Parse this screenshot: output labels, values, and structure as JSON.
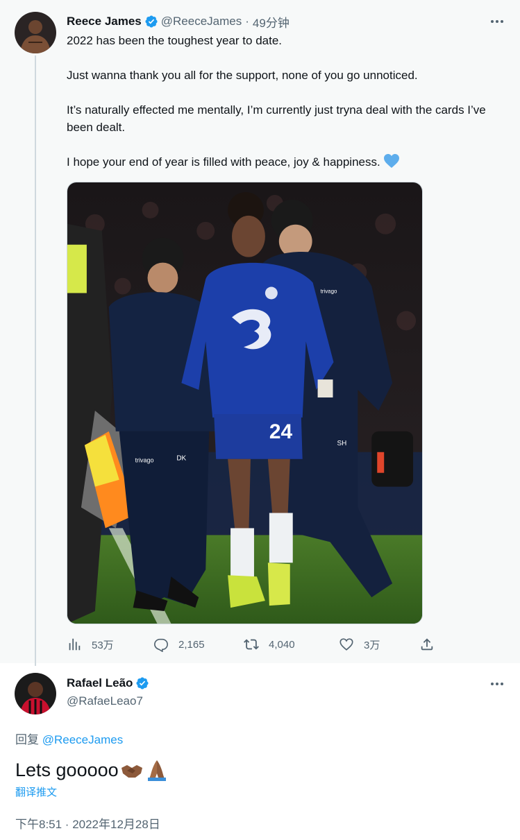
{
  "tweet": {
    "name": "Reece James",
    "handle": "@ReeceJames",
    "separator": "·",
    "time": "49分钟",
    "paragraphs": [
      "2022 has been the toughest year to date.",
      "Just wanna thank you all for the support, none of you go unnoticed.",
      "It’s naturally effected me mentally, I’m currently just tryna deal with the cards I’ve been dealt.",
      "I hope your end of year is filled with peace, joy & happiness."
    ],
    "emoji_icon": "blue-heart",
    "photo": {
      "shirt_number": "24",
      "staff_initials_left": "DK",
      "staff_initials_right": "SH",
      "sponsor": "trivago"
    },
    "actions": {
      "views": "53万",
      "replies": "2,165",
      "retweets": "4,040",
      "likes": "3万"
    }
  },
  "reply": {
    "name": "Rafael Leão",
    "handle": "@RafaeLeao7",
    "reply_label": "回复",
    "reply_mention": "@ReeceJames",
    "text": "Lets gooooo",
    "emoji_icons": [
      "handshake-icon",
      "folded-hands-icon"
    ],
    "translate_label": "翻译推文",
    "timestamp": "下午8:51 · 2022年12月28日"
  },
  "colors": {
    "accent": "#1d9bf0",
    "text": "#0f1419",
    "muted": "#536471",
    "quoted_bg": "#f7f9f9",
    "chelsea_blue": "#1c3faa"
  }
}
